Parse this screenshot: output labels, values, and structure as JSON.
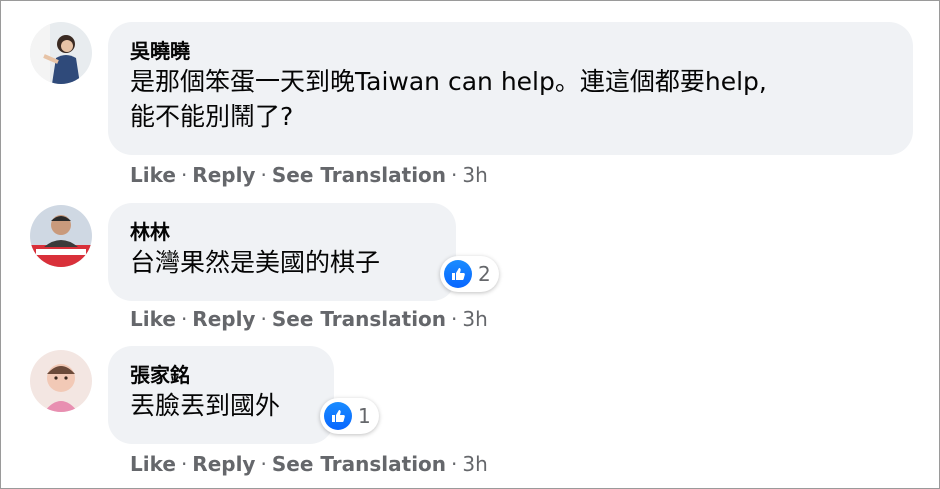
{
  "comments": [
    {
      "author": "吳曉曉",
      "text_lines": [
        "是那個笨蛋一天到晚Taiwan can help。連這個都要help,",
        "能不能別鬧了?"
      ],
      "actions": {
        "like": "Like",
        "reply": "Reply",
        "translate": "See Translation",
        "time": "3h"
      }
    },
    {
      "author": "林林",
      "text_lines": [
        "台灣果然是美國的棋子"
      ],
      "reaction_count": "2",
      "actions": {
        "like": "Like",
        "reply": "Reply",
        "translate": "See Translation",
        "time": "3h"
      }
    },
    {
      "author": "張家銘",
      "text_lines": [
        "丟臉丟到國外"
      ],
      "reaction_count": "1",
      "actions": {
        "like": "Like",
        "reply": "Reply",
        "translate": "See Translation",
        "time": "3h"
      }
    }
  ],
  "colors": {
    "bubble": "#f0f2f5",
    "meta_text": "#65676b",
    "body_text": "#050505",
    "like_blue": "#0866ff"
  },
  "icons": {
    "reaction": "thumbs-up-icon"
  }
}
